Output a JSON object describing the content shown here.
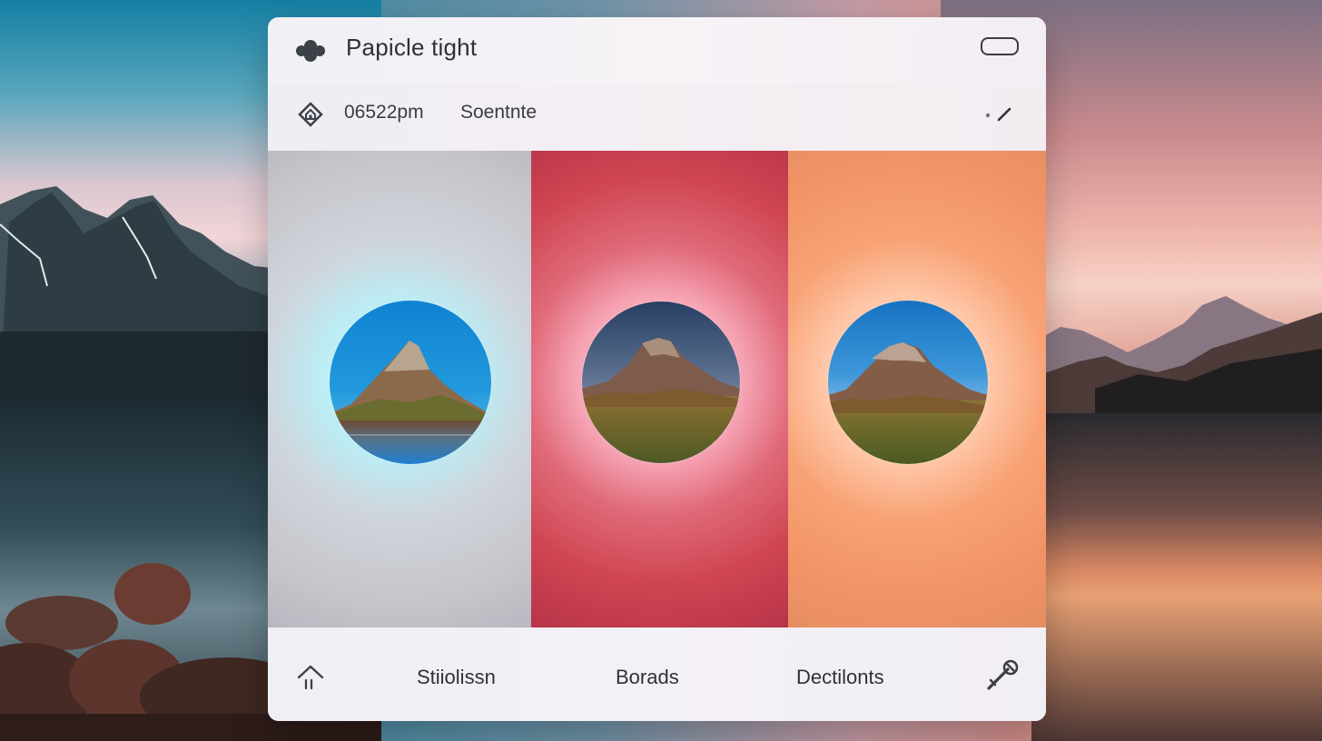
{
  "header": {
    "title": "Papicle tight",
    "app_icon": "app-logo-icon",
    "window_control_icon": "window-toggle-icon"
  },
  "info": {
    "time": "06522pm",
    "name": "Soentnte",
    "location_icon": "location-home-icon",
    "edit_icon": "edit-icon"
  },
  "gallery": {
    "panels": [
      {
        "image": "mountain-thumbnail-1"
      },
      {
        "image": "mountain-thumbnail-2"
      },
      {
        "image": "mountain-thumbnail-3"
      }
    ]
  },
  "bottom_nav": {
    "home_icon": "home-icon",
    "items": [
      {
        "label": "Stiiolissn"
      },
      {
        "label": "Borads"
      },
      {
        "label": "Dectilonts"
      }
    ],
    "tool_icon": "magic-wand-icon"
  },
  "colors": {
    "panel_1": "#c6c4ca",
    "panel_2": "#cf4552",
    "panel_3": "#f09467"
  }
}
